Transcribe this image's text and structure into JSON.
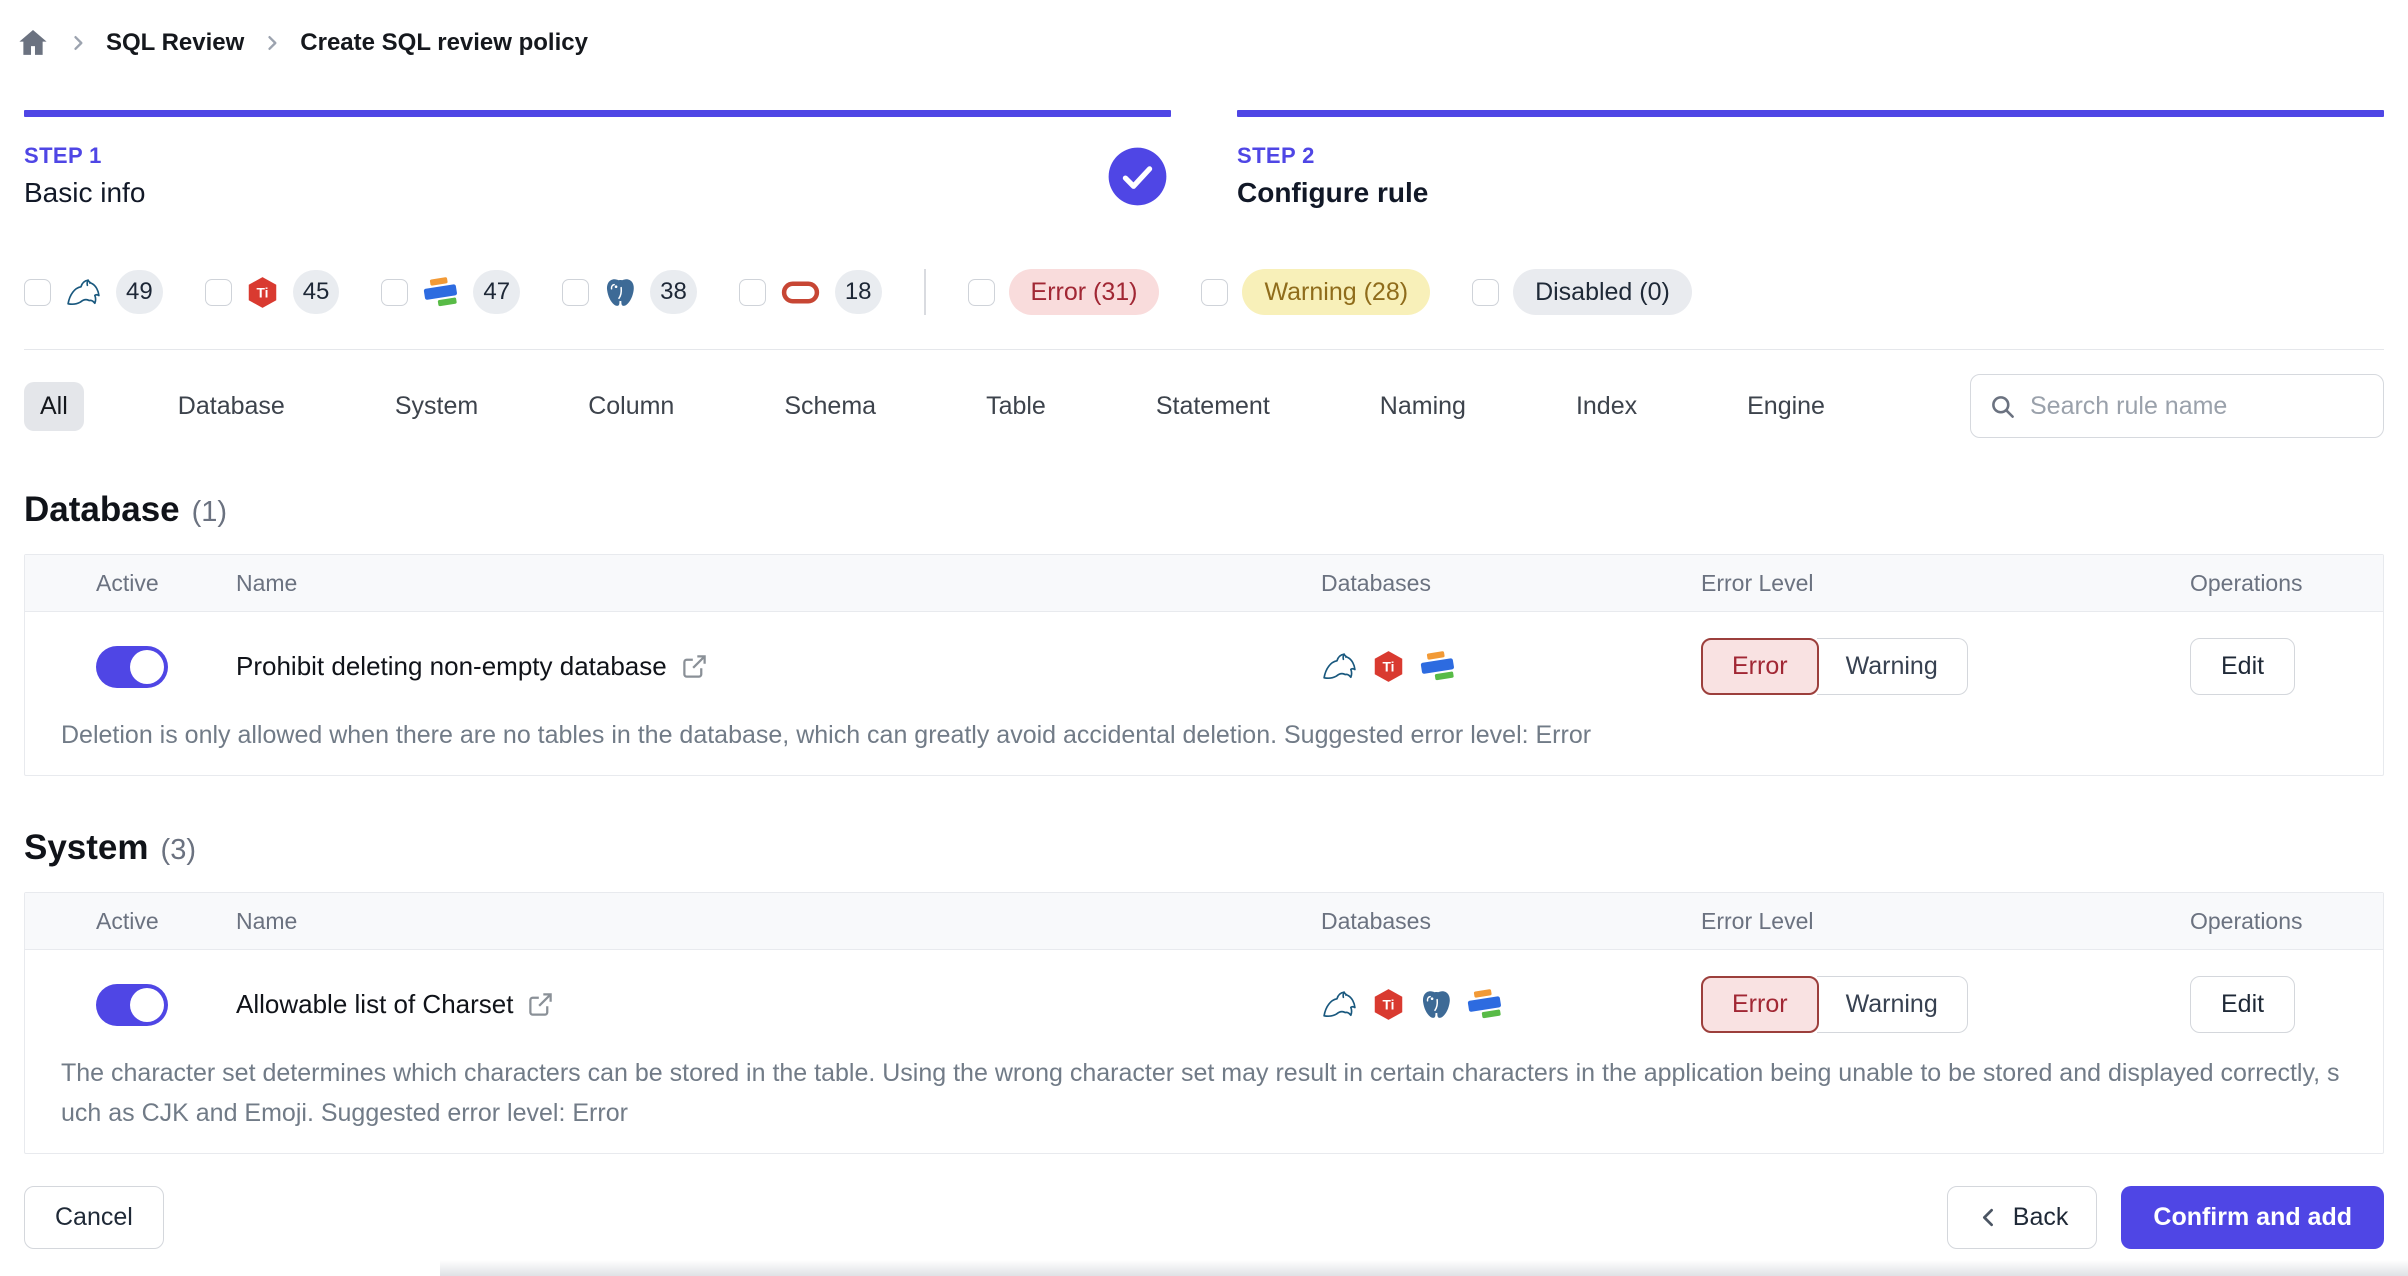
{
  "breadcrumb": {
    "items": [
      "SQL Review",
      "Create SQL review policy"
    ]
  },
  "steps": [
    {
      "label": "STEP 1",
      "title": "Basic info",
      "status": "completed"
    },
    {
      "label": "STEP 2",
      "title": "Configure rule",
      "status": "current"
    }
  ],
  "filters": {
    "engines": [
      {
        "engine": "mysql",
        "count": "49"
      },
      {
        "engine": "tidb",
        "count": "45"
      },
      {
        "engine": "oceanbase",
        "count": "47"
      },
      {
        "engine": "postgresql",
        "count": "38"
      },
      {
        "engine": "oracle",
        "count": "18"
      }
    ],
    "levels": [
      {
        "label": "Error (31)",
        "type": "error"
      },
      {
        "label": "Warning (28)",
        "type": "warning"
      },
      {
        "label": "Disabled (0)",
        "type": "disabled"
      }
    ]
  },
  "tabs": {
    "active": "All",
    "items": [
      "All",
      "Database",
      "System",
      "Column",
      "Schema",
      "Table",
      "Statement",
      "Naming",
      "Index",
      "Engine"
    ]
  },
  "search": {
    "placeholder": "Search rule name"
  },
  "rule_table": {
    "headers": [
      "Active",
      "Name",
      "Databases",
      "Error Level",
      "Operations"
    ],
    "level_options": [
      "Error",
      "Warning"
    ],
    "edit_label": "Edit"
  },
  "sections": [
    {
      "title": "Database",
      "count": "(1)",
      "rules": [
        {
          "name": "Prohibit deleting non-empty database",
          "active": true,
          "engines": [
            "mysql",
            "tidb",
            "oceanbase"
          ],
          "level": "Error",
          "description": "Deletion is only allowed when there are no tables in the database, which can greatly avoid accidental deletion. Suggested error level: Error"
        }
      ]
    },
    {
      "title": "System",
      "count": "(3)",
      "rules": [
        {
          "name": "Allowable list of Charset",
          "active": true,
          "engines": [
            "mysql",
            "tidb",
            "postgresql",
            "oceanbase"
          ],
          "level": "Error",
          "description": "The character set determines which characters can be stored in the table. Using the wrong character set may result in certain characters in the application being unable to be stored and displayed correctly, such as CJK and Emoji. Suggested error level: Error"
        }
      ]
    }
  ],
  "footer": {
    "cancel": "Cancel",
    "back": "Back",
    "confirm": "Confirm and add"
  },
  "colors": {
    "accent": "#4f46e5",
    "error_text": "#a12734",
    "error_bg": "#f9dcdc",
    "warning_text": "#8f6c1b",
    "warning_bg": "#f8f0b9",
    "disabled_bg": "#e9ebef",
    "oracle_red": "#c74634",
    "tidb_red": "#d93a30",
    "postgres_blue": "#3d6a96",
    "mysql_teal": "#19587e",
    "oceanbase_orange": "#f29a36",
    "oceanbase_blue": "#2d6be0",
    "oceanbase_green": "#58bb46"
  }
}
